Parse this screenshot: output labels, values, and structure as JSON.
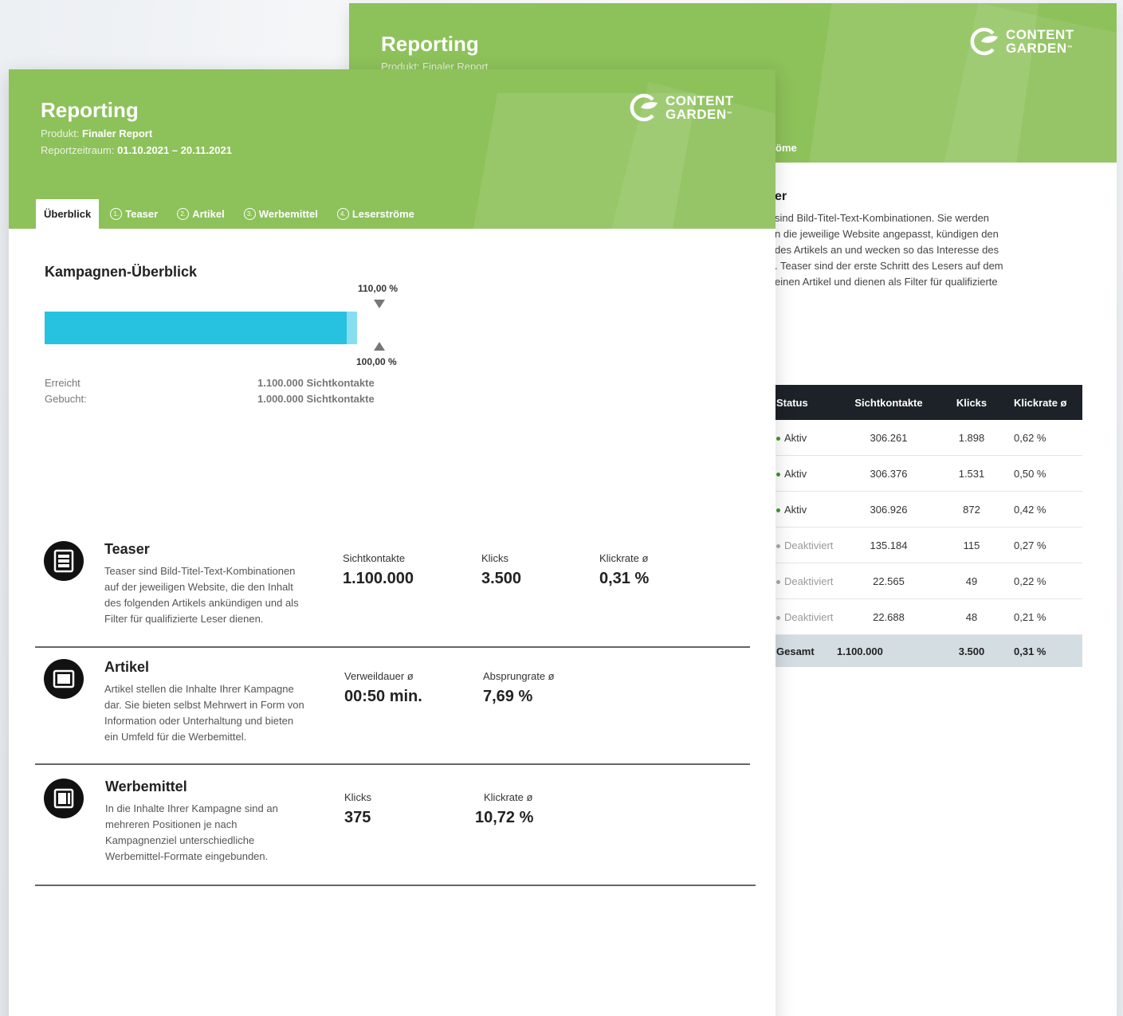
{
  "colors": {
    "header_green": "#8dc15a",
    "bar_blue": "#27c2e0",
    "bar_overflow": "#87def0",
    "table_head": "#1c2227",
    "total_row": "#d3dde2",
    "status_active": "#3f9a2a"
  },
  "brand": {
    "line1": "CONTENT",
    "line2": "GARDEN",
    "tm": "™"
  },
  "back": {
    "title": "Reporting",
    "product_fragment": "Produkt: Finaler Report",
    "tab_fragment": "röme",
    "heading_fragment": "er",
    "para_lines": [
      "sind Bild-Titel-Text-Kombinationen. Sie werden",
      "n die jeweilige Website angepasst, kündigen den",
      "des Artikels an und wecken so das Interesse des",
      ". Teaser sind der erste Schritt des Lesers auf dem",
      "einen Artikel und dienen als Filter für qualifizierte"
    ],
    "table": {
      "headers": [
        "Status",
        "Sichtkontakte",
        "Klicks",
        "Klickrate ø"
      ],
      "rows": [
        {
          "status": "Aktiv",
          "sicht": "306.261",
          "klicks": "1.898",
          "rate": "0,62 %"
        },
        {
          "status": "Aktiv",
          "sicht": "306.376",
          "klicks": "1.531",
          "rate": "0,50 %"
        },
        {
          "status": "Aktiv",
          "sicht": "306.926",
          "klicks": "872",
          "rate": "0,42 %"
        },
        {
          "status": "Deaktiviert",
          "sicht": "135.184",
          "klicks": "115",
          "rate": "0,27 %"
        },
        {
          "status": "Deaktiviert",
          "sicht": "22.565",
          "klicks": "49",
          "rate": "0,22 %"
        },
        {
          "status": "Deaktiviert",
          "sicht": "22.688",
          "klicks": "48",
          "rate": "0,21 %"
        }
      ],
      "total": {
        "label": "Gesamt",
        "sicht": "1.100.000",
        "klicks": "3.500",
        "rate": "0,31 %"
      }
    }
  },
  "front": {
    "title": "Reporting",
    "product_label": "Produkt:",
    "product_value": "Finaler Report",
    "period_label": "Reportzeitraum:",
    "period_value": "01.10.2021 – 20.11.2021",
    "tabs": [
      {
        "num": "",
        "label": "Überblick"
      },
      {
        "num": "1.",
        "label": "Teaser"
      },
      {
        "num": "2.",
        "label": "Artikel"
      },
      {
        "num": "3.",
        "label": "Werbemittel"
      },
      {
        "num": "4.",
        "label": "Leserströme"
      }
    ],
    "overview": {
      "title": "Kampagnen-Überblick",
      "top_label": "110,00 %",
      "bottom_label": "100,00 %",
      "reached_fraction": 1.1,
      "booked_fraction": 1.0,
      "reached_label": "Erreicht",
      "reached_value": "1.100.000 Sichtkontakte",
      "booked_label": "Gebucht:",
      "booked_value": "1.000.000 Sichtkontakte"
    },
    "teaser": {
      "icon": "teaser-icon",
      "title": "Teaser",
      "desc_lines": [
        "Teaser sind Bild-Titel-Text-Kombinationen",
        "auf der jeweiligen Website, die den Inhalt",
        "des folgenden Artikels ankündigen und als",
        "Filter für qualifizierte Leser dienen."
      ],
      "m1_label": "Sichtkontakte",
      "m1_value": "1.100.000",
      "m2_label": "Klicks",
      "m2_value": "3.500",
      "m3_label": "Klickrate ø",
      "m3_value": "0,31 %"
    },
    "artikel": {
      "icon": "article-icon",
      "title": "Artikel",
      "desc_lines": [
        "Artikel stellen die Inhalte Ihrer Kampagne",
        "dar. Sie bieten selbst Mehrwert in Form von",
        "Information oder Unterhaltung und bieten",
        "ein Umfeld für die Werbemittel."
      ],
      "m1_label": "Verweildauer ø",
      "m1_value": "00:50 min.",
      "m2_label": "Absprungrate ø",
      "m2_value": "7,69 %"
    },
    "werbemittel": {
      "icon": "ad-icon",
      "title": "Werbemittel",
      "desc_lines": [
        "In die Inhalte Ihrer Kampagne sind an",
        "mehreren Positionen je nach",
        "Kampagnenziel unterschiedliche",
        "Werbemittel-Formate eingebunden."
      ],
      "m1_label": "Klicks",
      "m1_value": "375",
      "m2_label": "Klickrate ø",
      "m2_value": "10,72 %"
    }
  }
}
